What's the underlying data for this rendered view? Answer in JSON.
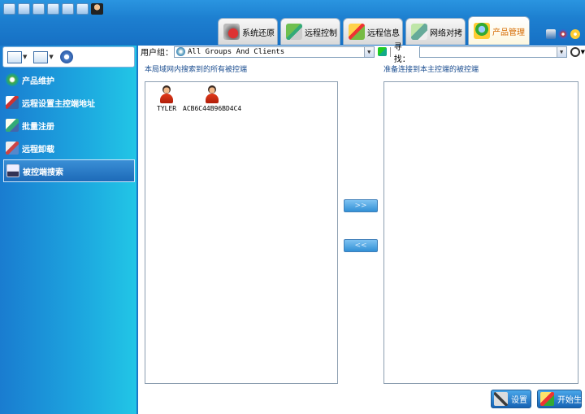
{
  "tabs": [
    {
      "label": "系统还原",
      "icon": "system-restore-icon"
    },
    {
      "label": "远程控制",
      "icon": "remote-control-icon"
    },
    {
      "label": "远程信息",
      "icon": "remote-info-icon"
    },
    {
      "label": "网络对拷",
      "icon": "network-copy-icon"
    },
    {
      "label": "产品管理",
      "icon": "product-management-icon",
      "active": true
    }
  ],
  "sidebar": {
    "items": [
      {
        "label": "产品维护",
        "icon": "product-maintenance-icon"
      },
      {
        "label": "远程设置主控端地址",
        "icon": "remote-set-master-address-icon"
      },
      {
        "label": "批量注册",
        "icon": "batch-register-icon"
      },
      {
        "label": "远程卸载",
        "icon": "remote-uninstall-icon"
      },
      {
        "label": "被控端搜索",
        "icon": "client-search-icon",
        "selected": true
      }
    ]
  },
  "filter": {
    "group_label": "用户组：",
    "group_value": "All Groups And Clients",
    "search_label": "寻找：",
    "search_value": ""
  },
  "lists": {
    "left_title": "本局域网内搜索到的所有被控端",
    "right_title": "准备连接到本主控端的被控端",
    "clients": [
      {
        "name": "TYLER"
      },
      {
        "name": "ACB6C44B96BD4C4"
      }
    ]
  },
  "buttons": {
    "move_right": ">>",
    "move_left": "<<",
    "settings": "设置",
    "apply": "开始生效"
  },
  "colors": {
    "accent": "#1a78c8",
    "sidebar_light": "#22c6e6",
    "active_tab_text": "#d66a00"
  }
}
